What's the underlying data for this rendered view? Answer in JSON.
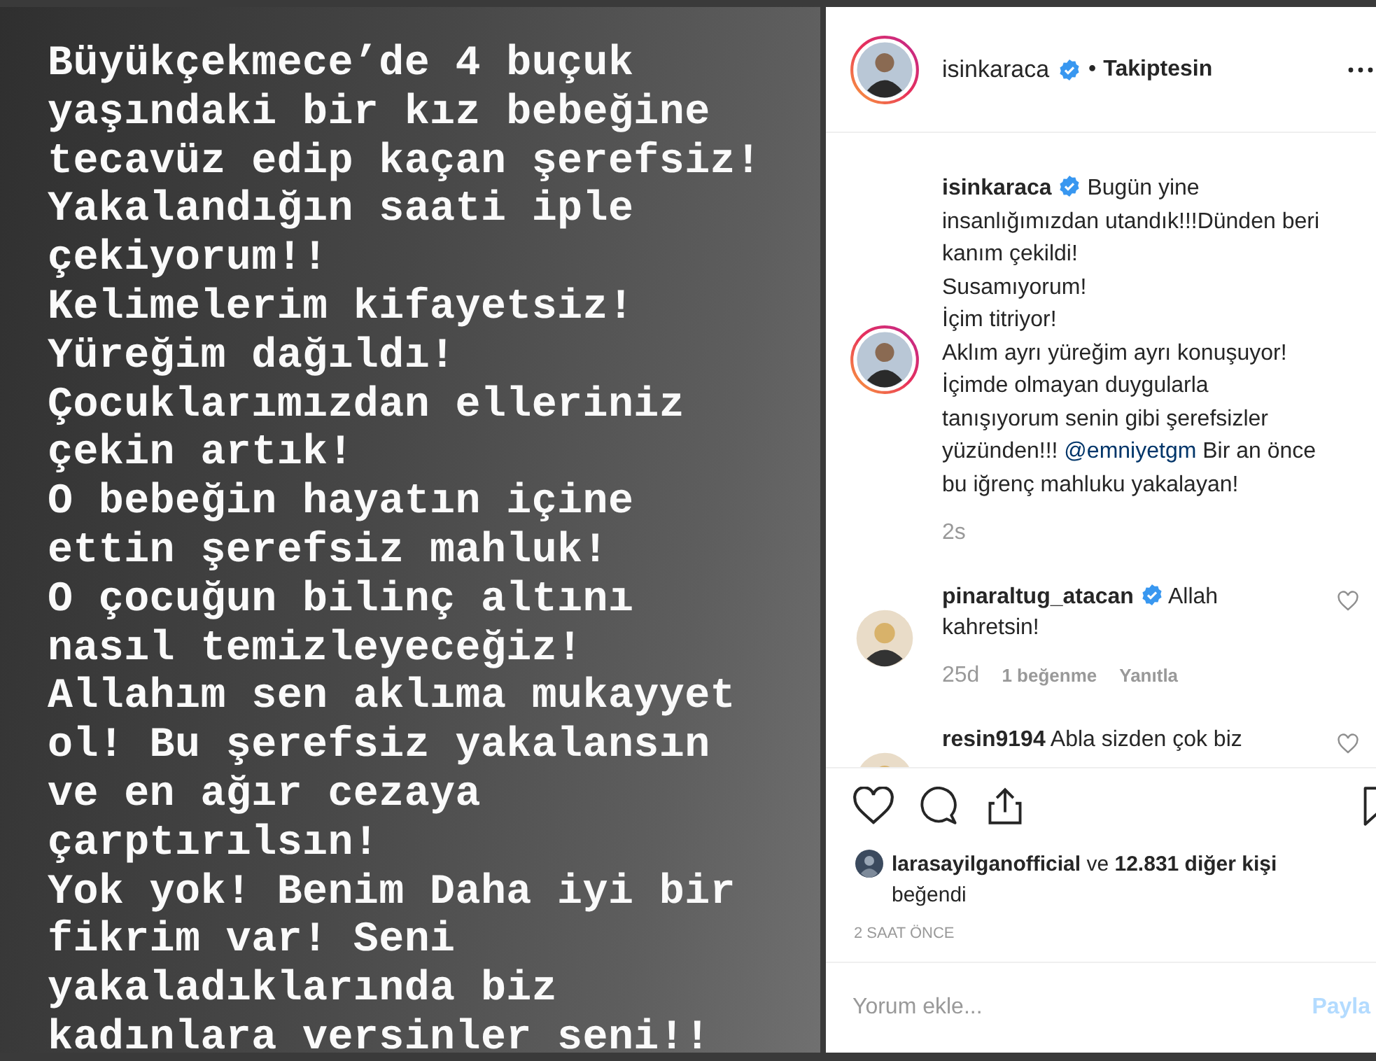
{
  "post_image": {
    "lines": [
      "Büyükçekmece’de 4 buçuk",
      "yaşındaki bir kız bebeğine",
      "tecavüz edip kaçan şerefsiz!",
      "Yakalandığın saati iple",
      "çekiyorum!!",
      "Kelimelerim kifayetsiz!",
      "Yüreğim dağıldı!",
      "Çocuklarımızdan elleriniz",
      "çekin artık!",
      "O bebeğin hayatın içine",
      "ettin şerefsiz mahluk!",
      "O çocuğun bilinç altını",
      "nasıl temizleyeceğiz!",
      "Allahım sen aklıma mukayyet",
      "ol! Bu şerefsiz yakalansın",
      "ve en ağır cezaya",
      "çarptırılsın!",
      "Yok yok! Benim Daha iyi bir",
      "fikrim var! Seni",
      "yakaladıklarında biz",
      "kadınlara versinler seni!!"
    ]
  },
  "header": {
    "username": "isinkaraca",
    "verified": true,
    "separator": "•",
    "follow_status": "Takiptesin"
  },
  "caption": {
    "username": "isinkaraca",
    "verified": true,
    "lines": [
      [
        {
          "kind": "text",
          "text": "Bugün yine"
        }
      ],
      [
        {
          "kind": "text",
          "text": "insanlığımızdan utandık!!!Dünden beri"
        }
      ],
      [
        {
          "kind": "text",
          "text": "kanım çekildi!"
        }
      ],
      [
        {
          "kind": "text",
          "text": "Susamıyorum!"
        }
      ],
      [
        {
          "kind": "text",
          "text": "İçim titriyor!"
        }
      ],
      [
        {
          "kind": "text",
          "text": "Aklım ayrı yüreğim ayrı konuşuyor!"
        }
      ],
      [
        {
          "kind": "text",
          "text": "İçimde olmayan duygularla"
        }
      ],
      [
        {
          "kind": "text",
          "text": "tanışıyorum senin gibi şerefsizler"
        }
      ],
      [
        {
          "kind": "text",
          "text": "yüzünden!!! "
        },
        {
          "kind": "mention",
          "text": "@emniyetgm"
        },
        {
          "kind": "text",
          "text": " Bir an önce"
        }
      ],
      [
        {
          "kind": "text",
          "text": "bu iğrenç mahluku yakalayan!"
        }
      ]
    ],
    "time": "2s"
  },
  "comments": [
    {
      "username": "pinaraltug_atacan",
      "verified": true,
      "text": "Allah kahretsin!",
      "time": "25d",
      "likes": "1 beğenme",
      "reply": "Yanıtla",
      "liked": false
    },
    {
      "username": "resin9194",
      "verified": false,
      "text": "Abla sizden çok biz",
      "liked": false
    }
  ],
  "actions": {
    "liked": false,
    "saved": false
  },
  "likes": {
    "text": "**larasayilganofficial** ve **12.831 diğer kişi** beğendi"
  },
  "timestamp": "2 SAAT ÖNCE",
  "comment_box": {
    "placeholder": "Yorum ekle...",
    "submit": "Payla",
    "disabled": true
  }
}
